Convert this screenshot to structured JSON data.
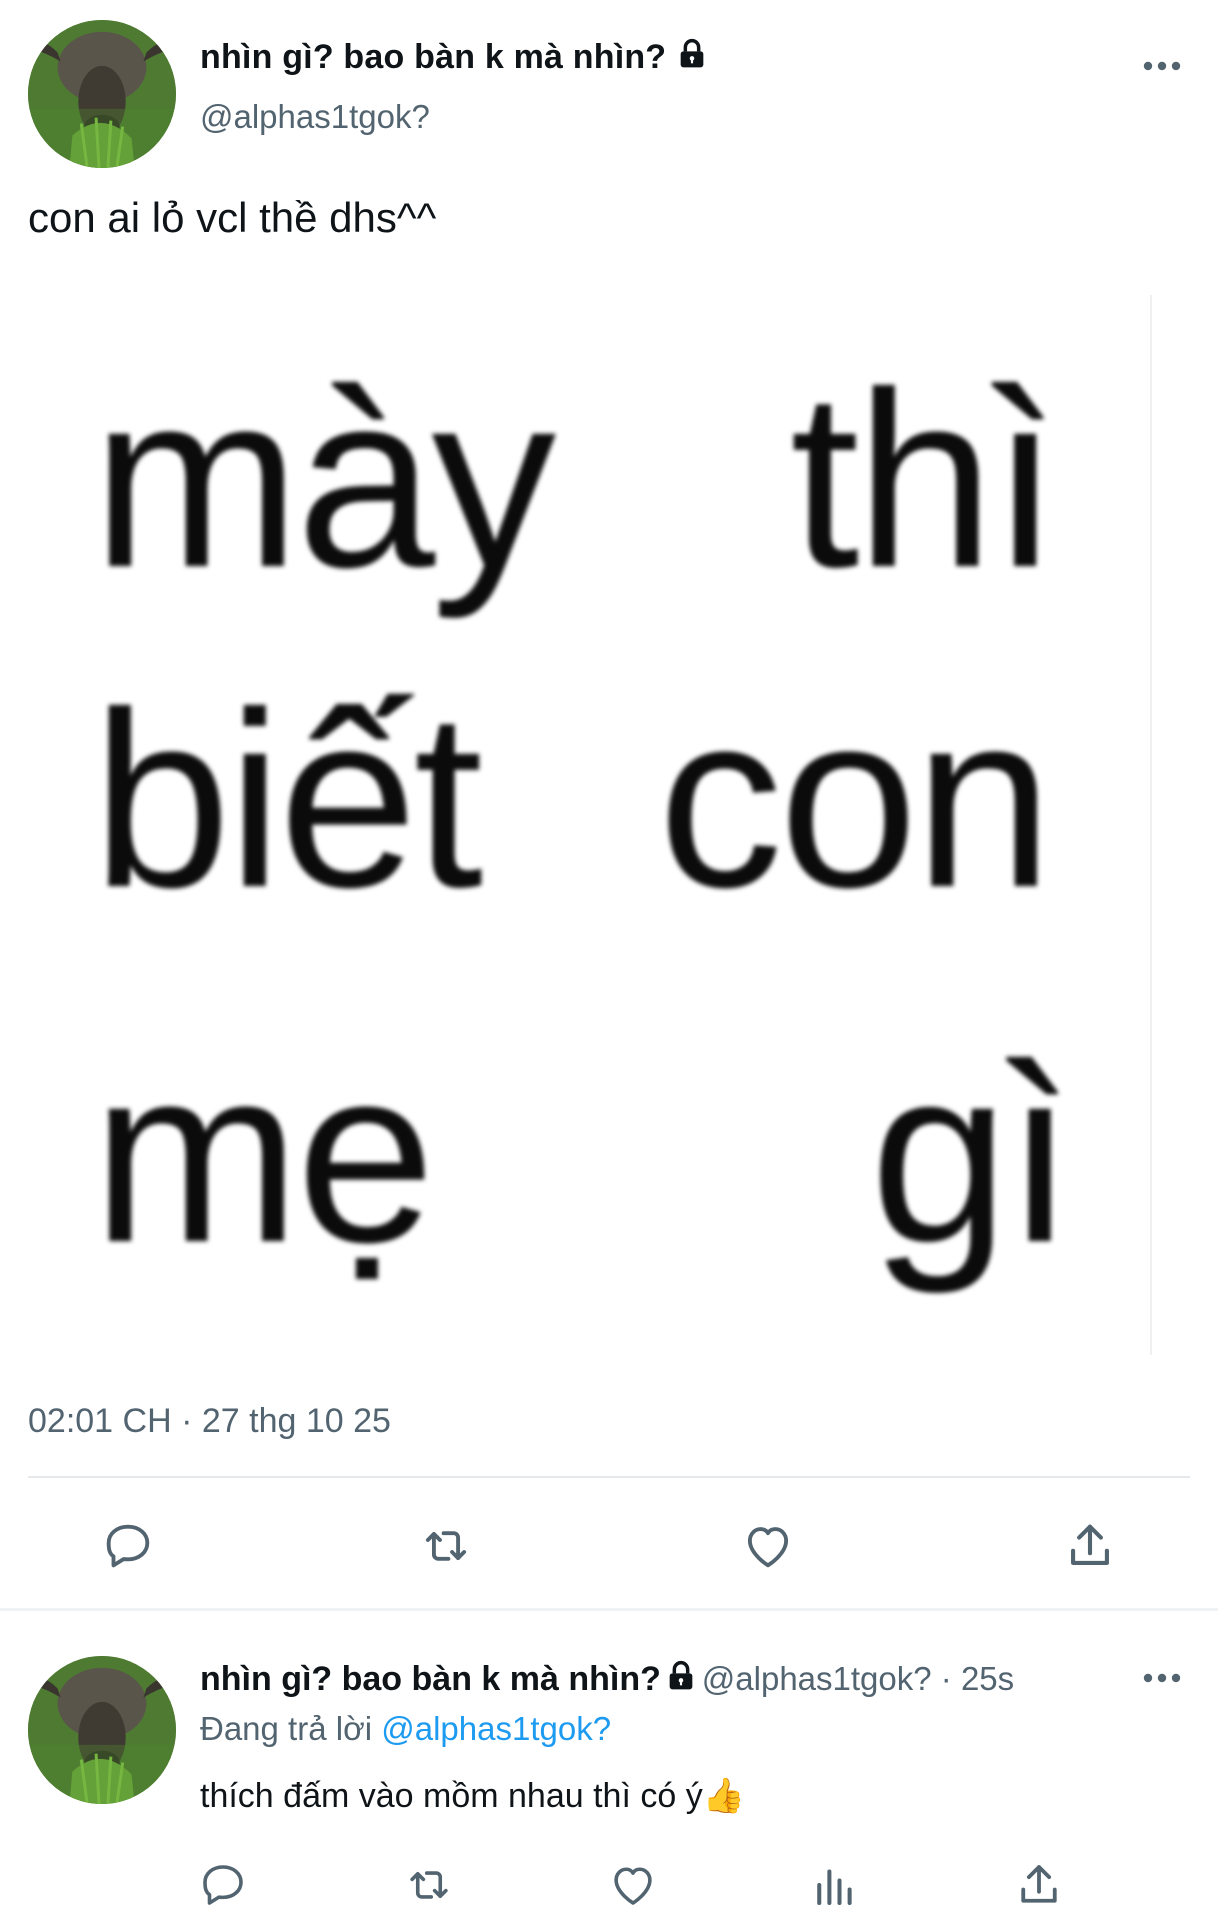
{
  "tweet": {
    "display_name": "nhìn gì? bao bàn k mà nhìn?",
    "handle": "@alphas1tgok?",
    "text": "con ai lỏ vcl thề dhs^^",
    "timestamp": "02:01 CH · 27 thg 10 25",
    "meme_words": [
      "mày",
      "thì",
      "biết",
      "con",
      "mẹ",
      "gì"
    ],
    "more_icon": "more-dots-icon"
  },
  "actions": {
    "icons": [
      "reply-icon",
      "retweet-icon",
      "like-icon",
      "share-icon"
    ]
  },
  "reply": {
    "display_name": "nhìn gì? bao bàn k mà nhìn?",
    "handle_time": "@alphas1tgok? · 25s",
    "replying_prefix": "Đang trả lời",
    "replying_mention": "@alphas1tgok?",
    "text": "thích đấm vào mồm nhau thì có ý",
    "emoji": "👍",
    "icons": [
      "reply-icon",
      "retweet-icon",
      "like-icon",
      "views-icon",
      "share-icon"
    ]
  },
  "colors": {
    "link": "#1d9bf0",
    "secondary_text": "#536471",
    "primary_text": "#0f1419"
  }
}
